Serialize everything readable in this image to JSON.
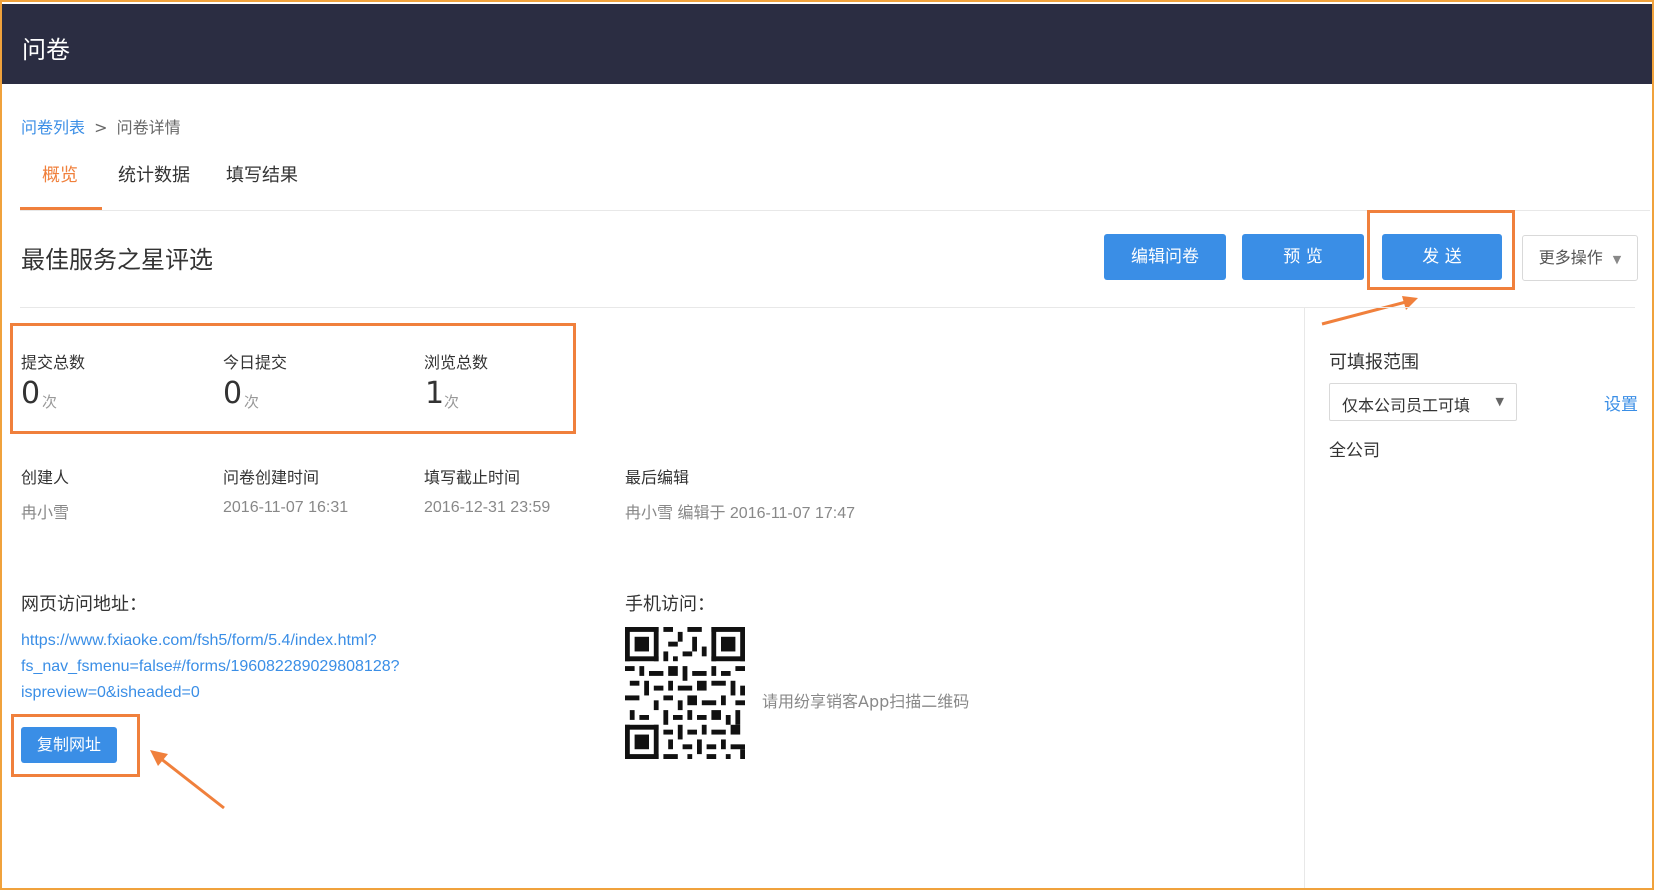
{
  "app": {
    "title": "问卷"
  },
  "breadcrumb": {
    "parent": "问卷列表",
    "separator": ">",
    "current": "问卷详情"
  },
  "tabs": [
    {
      "label": "概览",
      "active": true
    },
    {
      "label": "统计数据",
      "active": false
    },
    {
      "label": "填写结果",
      "active": false
    }
  ],
  "survey": {
    "title": "最佳服务之星评选"
  },
  "toolbar": {
    "edit_label": "编辑问卷",
    "preview_label": "预 览",
    "send_label": "发 送",
    "more_label": "更多操作"
  },
  "stats": [
    {
      "label": "提交总数",
      "value": "0",
      "unit": "次"
    },
    {
      "label": "今日提交",
      "value": "0",
      "unit": "次"
    },
    {
      "label": "浏览总数",
      "value": "1",
      "unit": "次"
    }
  ],
  "meta": [
    {
      "label": "创建人",
      "value": "冉小雪"
    },
    {
      "label": "问卷创建时间",
      "value": "2016-11-07 16:31"
    },
    {
      "label": "填写截止时间",
      "value": "2016-12-31 23:59"
    },
    {
      "label": "最后编辑",
      "value": "冉小雪 编辑于 2016-11-07 17:47"
    }
  ],
  "web_access": {
    "label": "网页访问地址：",
    "url_lines": [
      "https://www.fxiaoke.com/fsh5/form/5.4/index.html?",
      "fs_nav_fsmenu=false#/forms/196082289029808128?",
      "ispreview=0&isheaded=0"
    ],
    "copy_label": "复制网址"
  },
  "mobile_access": {
    "label": "手机访问：",
    "hint": "请用纷享销客App扫描二维码"
  },
  "sidebar": {
    "scope_label": "可填报范围",
    "select_value": "仅本公司员工可填",
    "settings_label": "设置",
    "scope_value": "全公司"
  },
  "colors": {
    "header_bg": "#2b2d42",
    "primary": "#3a8ee6",
    "highlight": "#f0803c"
  }
}
